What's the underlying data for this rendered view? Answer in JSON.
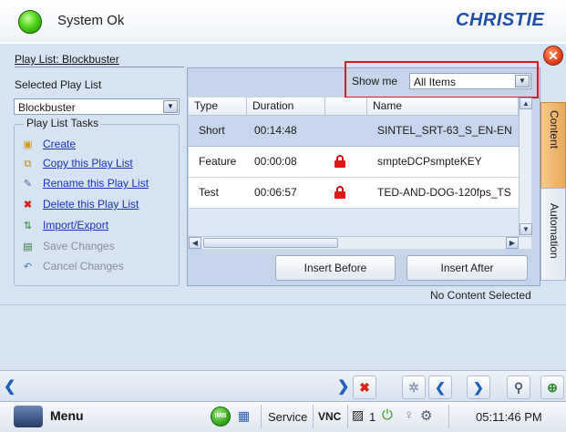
{
  "header": {
    "status_text": "System Ok",
    "logo_text": "CHRISTIE"
  },
  "panel": {
    "title": "Play List: Blockbuster",
    "selected_label": "Selected Play List",
    "selected_value": "Blockbuster",
    "tasks_legend": "Play List Tasks",
    "tasks": [
      {
        "label": "Create",
        "enabled": true,
        "icon": "new-file-icon"
      },
      {
        "label": "Copy this Play List",
        "enabled": true,
        "icon": "copy-icon"
      },
      {
        "label": "Rename this Play List",
        "enabled": true,
        "icon": "rename-icon"
      },
      {
        "label": "Delete this Play List",
        "enabled": true,
        "icon": "delete-x-icon"
      },
      {
        "label": "Import/Export",
        "enabled": true,
        "icon": "import-export-icon"
      },
      {
        "label": "Save Changes",
        "enabled": false,
        "icon": "save-icon"
      },
      {
        "label": "Cancel Changes",
        "enabled": false,
        "icon": "undo-icon"
      }
    ]
  },
  "filter": {
    "label": "Show me",
    "value": "All Items"
  },
  "grid": {
    "columns": [
      "Type",
      "Duration",
      "",
      "Name"
    ],
    "rows": [
      {
        "type": "Short",
        "duration": "00:14:48",
        "locked": false,
        "name": "SINTEL_SRT-63_S_EN-EN"
      },
      {
        "type": "Feature",
        "duration": "00:00:08",
        "locked": true,
        "name": "smpteDCPsmpteKEY"
      },
      {
        "type": "Test",
        "duration": "00:06:57",
        "locked": true,
        "name": "TED-AND-DOG-120fps_TS"
      }
    ]
  },
  "buttons": {
    "insert_before": "Insert Before",
    "insert_after": "Insert After"
  },
  "tabs": {
    "content": "Content",
    "automation": "Automation"
  },
  "status_message": "No Content Selected",
  "taskbar": {
    "menu": "Menu",
    "imb": "IMB",
    "service": "Service",
    "vnc": "VNC",
    "projector_count": "1",
    "time": "05:11:46 PM"
  },
  "colors": {
    "accent": "#1f4fa8",
    "highlight_box": "#e0141e",
    "panel_bg": "#d6e3f3",
    "selected_tab": "#f0b66a"
  }
}
